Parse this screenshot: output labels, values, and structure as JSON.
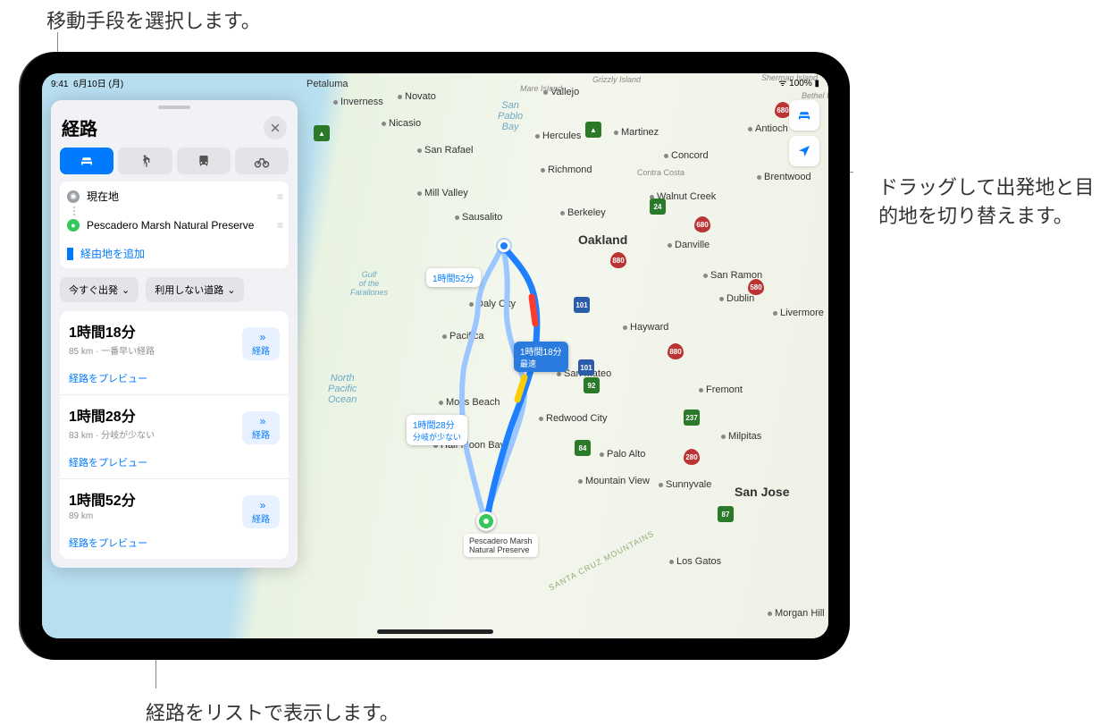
{
  "callouts": {
    "mode": "移動手段を選択します。",
    "drag": "ドラッグして出発地と目的地を切り替えます。",
    "list": "経路をリストで表示します。"
  },
  "status": {
    "time": "9:41",
    "date": "6月10日 (月)",
    "battery": "100%"
  },
  "card": {
    "title": "経路",
    "locations": {
      "from": "現在地",
      "to": "Pescadero Marsh Natural Preserve",
      "add_stop": "経由地を追加"
    },
    "options": {
      "depart": "今すぐ出発",
      "avoid": "利用しない道路"
    },
    "go_label": "経路",
    "preview_label": "経路をプレビュー",
    "routes": [
      {
        "time": "1時間18分",
        "detail": "85 km · 一番早い経路"
      },
      {
        "time": "1時間28分",
        "detail": "83 km · 分岐が少ない"
      },
      {
        "time": "1時間52分",
        "detail": "89 km"
      }
    ]
  },
  "map": {
    "ocean": "North\nPacific\nOcean",
    "bay": "San\nPablo\nBay",
    "gulf": "Gulf\nof the\nFarallones",
    "bubbles": {
      "r1a": "1時間18分",
      "r1b": "最速",
      "r2a": "1時間28分",
      "r2b": "分岐が少ない",
      "r3": "1時間52分"
    },
    "dest": "Pescadero Marsh\nNatural Preserve",
    "cities": {
      "san_rafael": "San Rafael",
      "novato": "Novato",
      "vallejo": "Vallejo",
      "petaluma": "Petaluma",
      "inverness": "Inverness",
      "nicasio": "Nicasio",
      "martinez": "Martinez",
      "concord": "Concord",
      "antioch": "Antioch",
      "brentwood": "Brentwood",
      "walnut_creek": "Walnut Creek",
      "danville": "Danville",
      "richmond": "Richmond",
      "berkeley": "Berkeley",
      "oakland": "Oakland",
      "hayward": "Hayward",
      "fremont": "Fremont",
      "livermore": "Livermore",
      "sausalito": "Sausalito",
      "mill_valley": "Mill Valley",
      "daly": "Daly City",
      "pacifica": "Pacifica",
      "san_mateo": "San Mateo",
      "redwood": "Redwood City",
      "palo_alto": "Palo Alto",
      "mtn_view": "Mountain View",
      "sunnyvale": "Sunnyvale",
      "san_jose": "San Jose",
      "milpitas": "Milpitas",
      "moss": "Moss Beach",
      "hercules": "Hercules",
      "contra": "Contra Costa",
      "hmb": "Half Moon Bay",
      "losgatos": "Los Gatos",
      "morganhill": "Morgan Hill",
      "sanramon": "San Ramon",
      "dublin": "Dublin",
      "bethel": "Bethel Island",
      "sherman": "Sherman Island",
      "grizzly": "Grizzly Island",
      "mare": "Mare Island",
      "santacruz": "SANTA CRUZ MOUNTAINS"
    }
  }
}
